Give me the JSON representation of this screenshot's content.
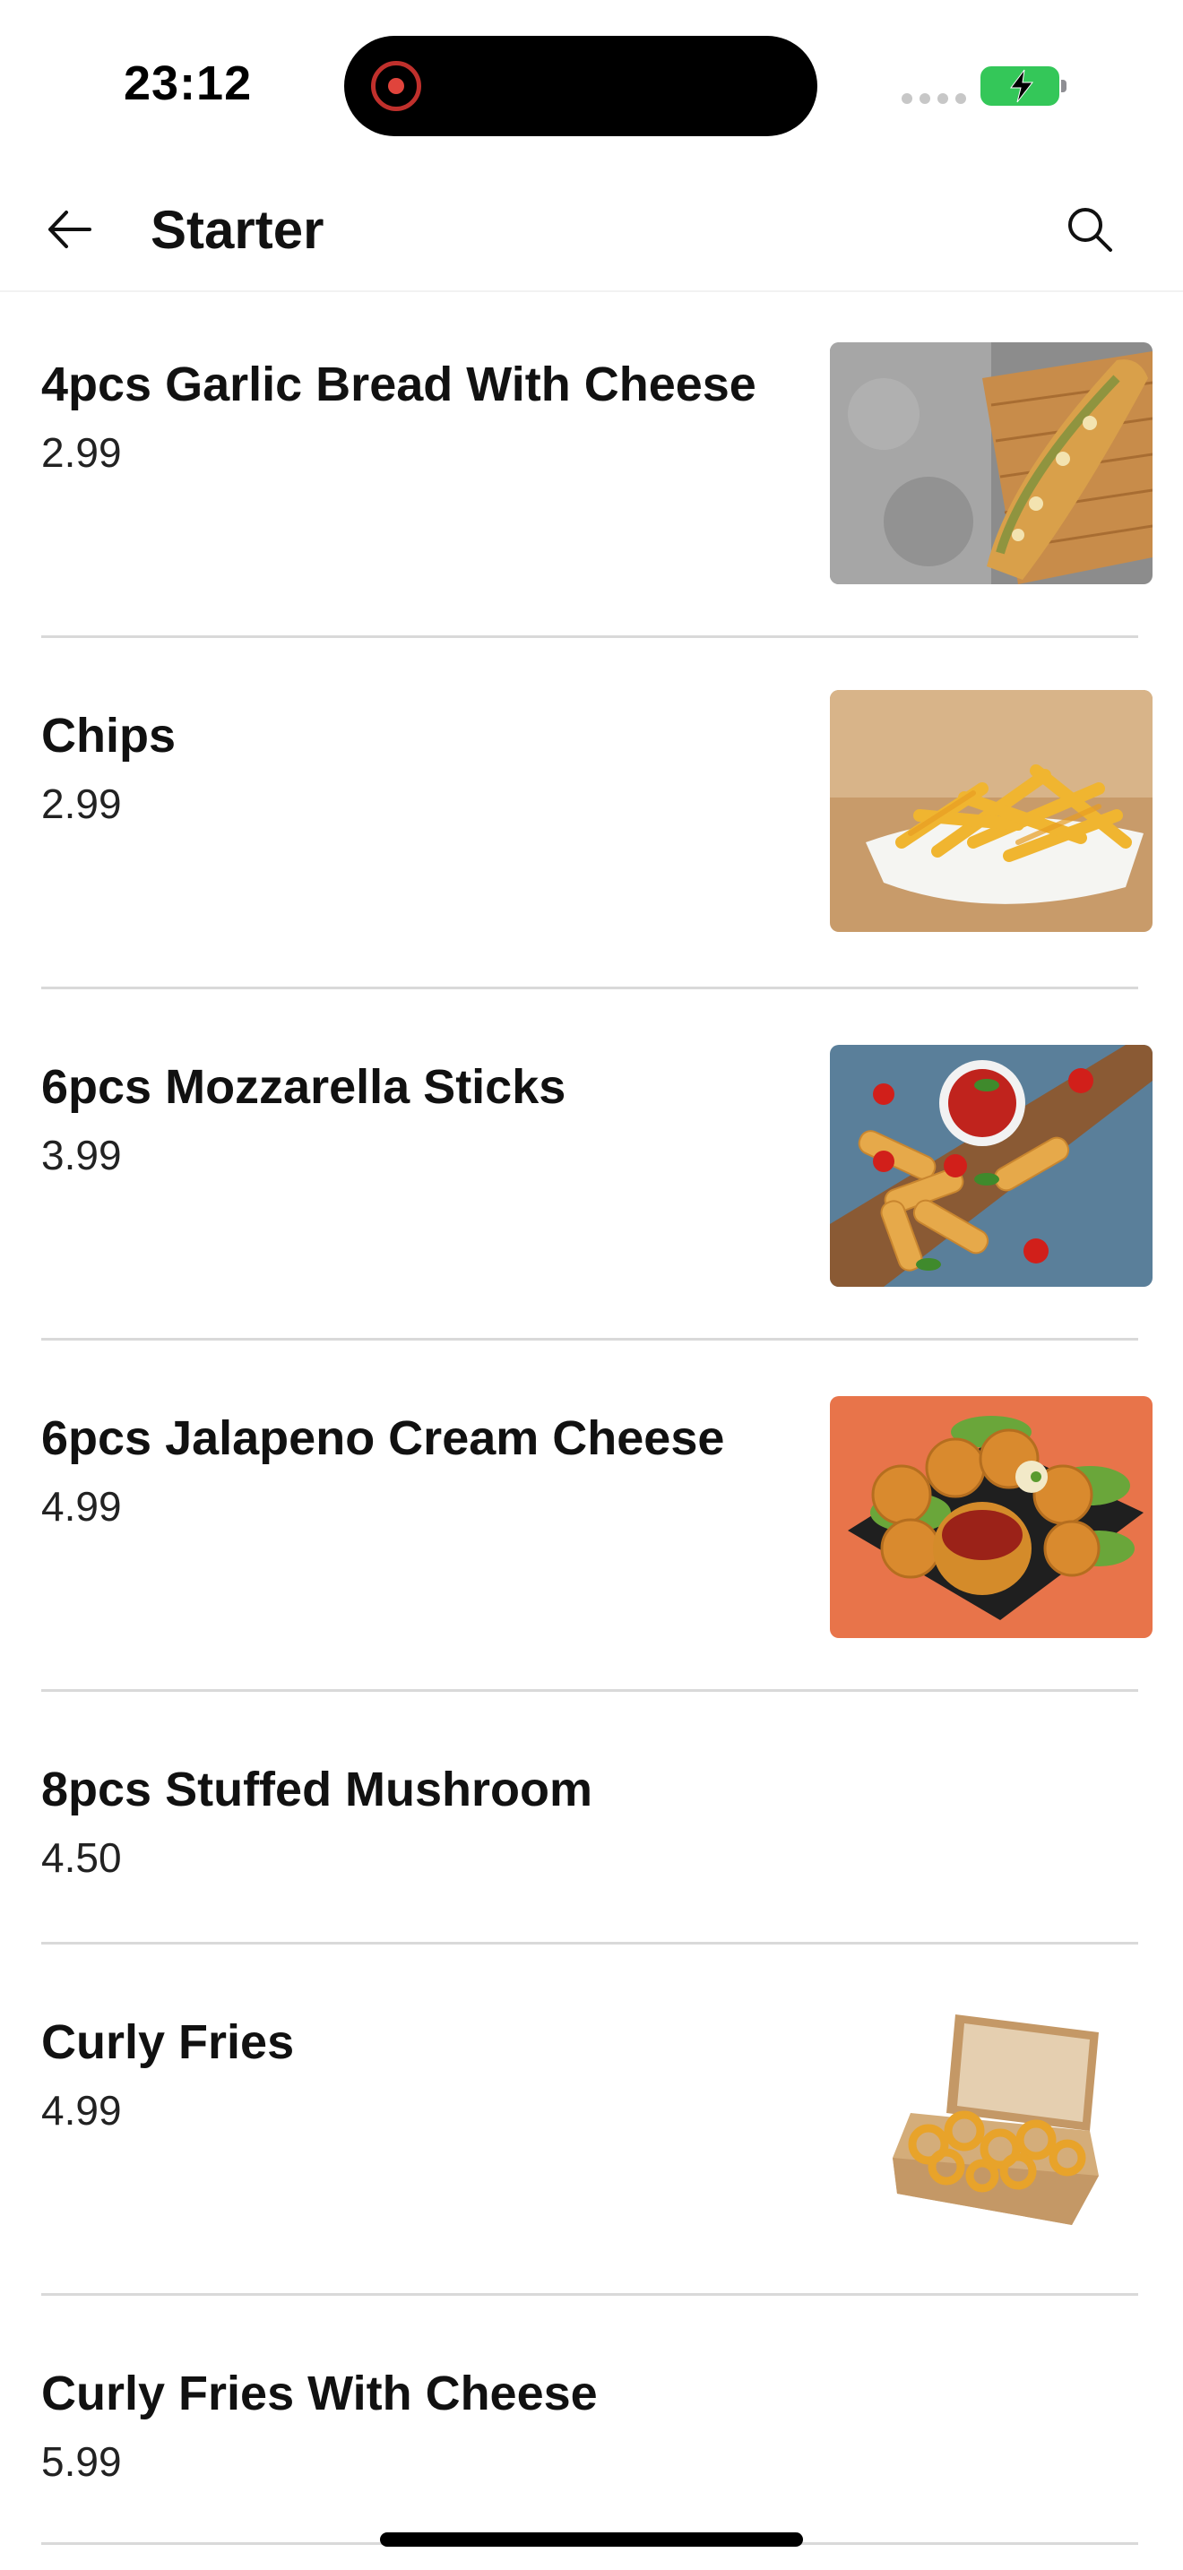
{
  "status_bar": {
    "time": "23:12"
  },
  "header": {
    "title": "Starter",
    "back_icon": "arrow-left-icon",
    "search_icon": "search-icon"
  },
  "menu": {
    "items": [
      {
        "name": "4pcs Garlic Bread With Cheese",
        "price": "2.99",
        "image": "garlic-bread-photo"
      },
      {
        "name": "Chips",
        "price": "2.99",
        "image": "chips-photo"
      },
      {
        "name": "6pcs Mozzarella Sticks",
        "price": "3.99",
        "image": "mozzarella-sticks-photo"
      },
      {
        "name": "6pcs Jalapeno Cream Cheese",
        "price": "4.99",
        "image": "jalapeno-poppers-photo"
      },
      {
        "name": "8pcs Stuffed Mushroom",
        "price": "4.50",
        "image": null
      },
      {
        "name": "Curly Fries",
        "price": "4.99",
        "image": "curly-fries-photo"
      },
      {
        "name": "Curly Fries With Cheese",
        "price": "5.99",
        "image": null
      }
    ]
  },
  "colors": {
    "battery": "#34c759",
    "divider": "#d9d9d9",
    "record": "#e0443c"
  }
}
